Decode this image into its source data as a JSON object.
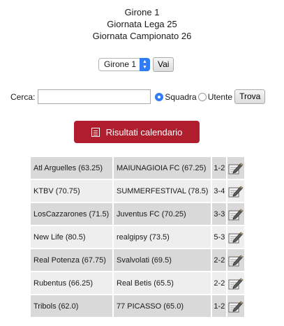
{
  "header": {
    "line1": "Girone 1",
    "line2": "Giornata Lega 25",
    "line3": "Giornata Campionato 26"
  },
  "group_select": {
    "value": "Girone 1",
    "go_label": "Vai"
  },
  "search": {
    "label": "Cerca:",
    "value": "",
    "option_team": "Squadra",
    "option_user": "Utente",
    "selected": "Squadra",
    "find_label": "Trova"
  },
  "results_button": {
    "label": "Risultati calendario",
    "color": "#b01e2e"
  },
  "matches": [
    {
      "home": "Atl Arguelles (63.25)",
      "away": "MAIUNAGIOIA FC (67.25)",
      "score": "1-2"
    },
    {
      "home": "KTBV (70.75)",
      "away": "SUMMERFESTIVAL (78.5)",
      "score": "3-4"
    },
    {
      "home": "LosCazzarones (71.5)",
      "away": "Juventus FC (70.25)",
      "score": "3-3"
    },
    {
      "home": "New Life (80.5)",
      "away": "realgipsy (73.5)",
      "score": "5-3"
    },
    {
      "home": "Real Potenza (67.75)",
      "away": "Svalvolati (69.5)",
      "score": "2-2"
    },
    {
      "home": "Rubentus (66.25)",
      "away": "Real Betis (65.5)",
      "score": "2-2"
    },
    {
      "home": "Tribols (62.0)",
      "away": "77 PICASSO (65.0)",
      "score": "1-2"
    }
  ]
}
